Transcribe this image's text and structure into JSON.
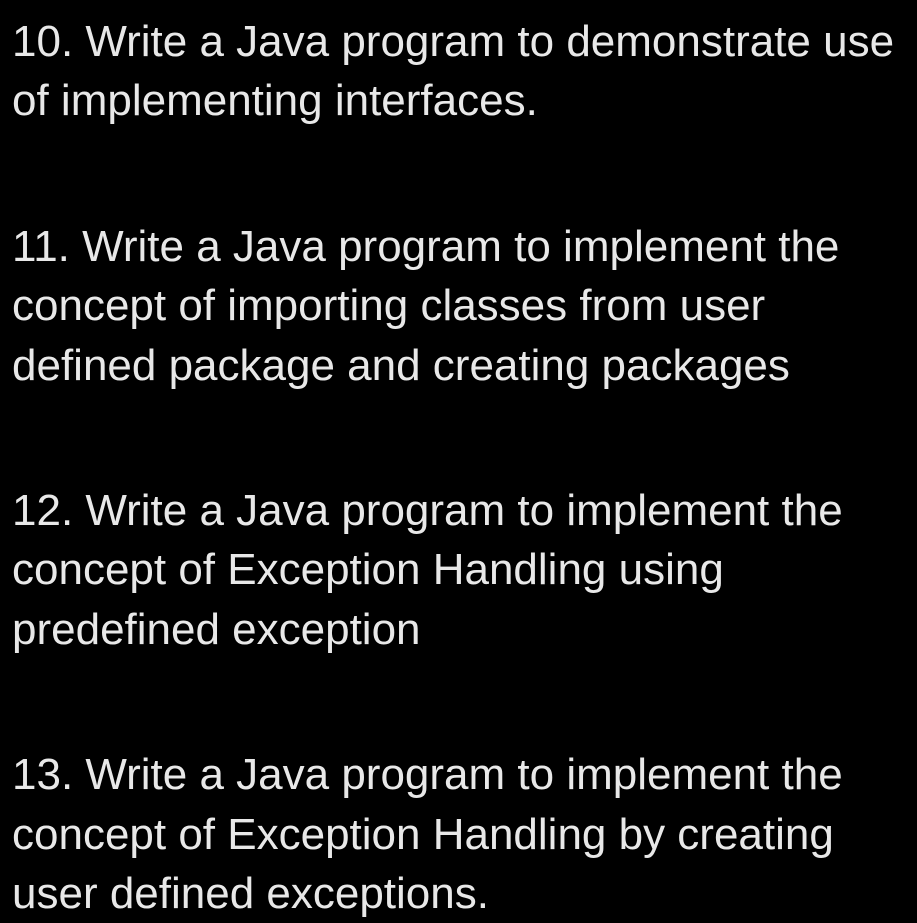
{
  "questions": [
    {
      "number": "10",
      "text": "10. Write a Java program to demonstrate use of implementing interfaces."
    },
    {
      "number": "11",
      "text": "11. Write a Java program to implement the concept of importing classes from user defined package and creating packages"
    },
    {
      "number": "12",
      "text": "12. Write a Java program to implement the concept of Exception Handling using predefined exception"
    },
    {
      "number": "13",
      "text": "13. Write a Java program to implement the concept of Exception Handling by creating user defined exceptions."
    }
  ]
}
